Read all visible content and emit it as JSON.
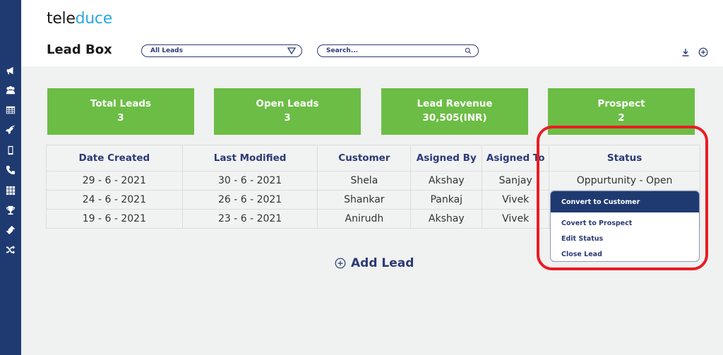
{
  "app": {
    "logo_part1": "tele",
    "logo_part2": "duce",
    "page_title": "Lead Box"
  },
  "colors": {
    "sidebar": "#1e3a70",
    "accent_green": "#6cbd45",
    "brand_blue": "#29a8e0",
    "text_navy": "#2b3a75",
    "highlight_red": "#ea1c24"
  },
  "sidebar": {
    "items": [
      {
        "icon": "megaphone-icon"
      },
      {
        "icon": "users-icon"
      },
      {
        "icon": "table-icon"
      },
      {
        "icon": "rocket-icon"
      },
      {
        "icon": "mobile-icon"
      },
      {
        "icon": "phone-icon"
      },
      {
        "icon": "grid-icon"
      },
      {
        "icon": "trophy-icon"
      },
      {
        "icon": "ticket-icon"
      },
      {
        "icon": "shuffle-icon"
      }
    ]
  },
  "toolbar": {
    "filter_value": "All Leads",
    "search_placeholder": "Search...",
    "download_icon": "download-icon",
    "add_icon": "plus-circle-icon"
  },
  "cards": [
    {
      "label": "Total Leads",
      "value": "3"
    },
    {
      "label": "Open Leads",
      "value": "3"
    },
    {
      "label": "Lead Revenue",
      "value": "30,505(INR)"
    },
    {
      "label": "Prospect",
      "value": "2"
    }
  ],
  "table": {
    "columns": [
      "Date Created",
      "Last Modified",
      "Customer",
      "Asigned By",
      "Asigned To",
      "Status"
    ],
    "rows": [
      [
        "29 - 6 - 2021",
        "30 - 6 - 2021",
        "Shela",
        "Akshay",
        "Sanjay",
        "Oppurtunity - Open"
      ],
      [
        "24 - 6 - 2021",
        "26 - 6 - 2021",
        "Shankar",
        "Pankaj",
        "Vivek",
        ""
      ],
      [
        "19 - 6 - 2021",
        "23 - 6 - 2021",
        "Anirudh",
        "Akshay",
        "Vivek",
        ""
      ]
    ]
  },
  "status_menu": {
    "items": [
      {
        "label": "Convert to Customer",
        "active": true
      },
      {
        "label": "Covert to Prospect",
        "active": false
      },
      {
        "label": "Edit Status",
        "active": false
      },
      {
        "label": "Close Lead",
        "active": false
      }
    ]
  },
  "add_lead": {
    "label": "Add Lead"
  }
}
